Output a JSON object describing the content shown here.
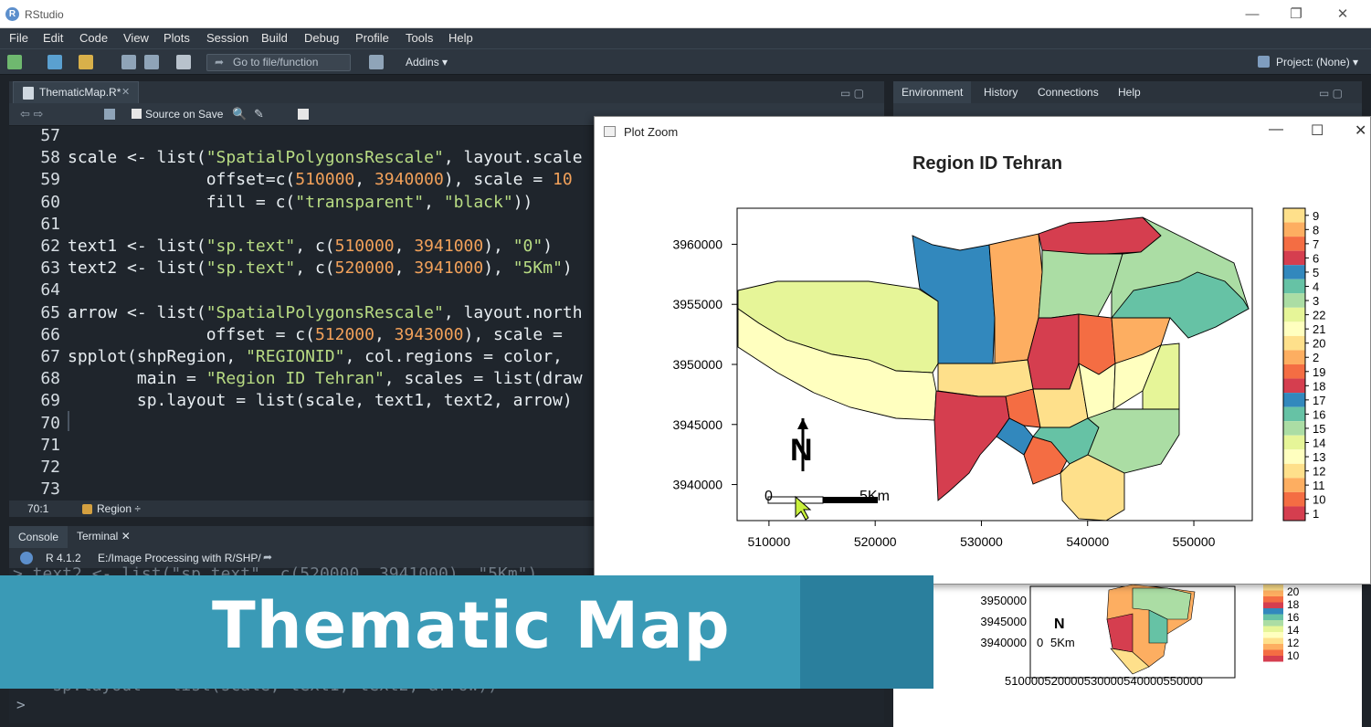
{
  "window": {
    "title": "RStudio"
  },
  "menu": [
    "File",
    "Edit",
    "Code",
    "View",
    "Plots",
    "Session",
    "Build",
    "Debug",
    "Profile",
    "Tools",
    "Help"
  ],
  "toolbar": {
    "goto_placeholder": "Go to file/function",
    "addins": "Addins",
    "project": "Project: (None)"
  },
  "editor": {
    "tab_label": "ThematicMap.R*",
    "source_on_save": "Source on Save",
    "lines": [
      {
        "no": "57",
        "segments": []
      },
      {
        "no": "58",
        "segments": [
          {
            "t": "scale <- list(",
            "c": ""
          },
          {
            "t": "\"SpatialPolygonsRescale\"",
            "c": "str"
          },
          {
            "t": ", layout.scale",
            "c": ""
          }
        ]
      },
      {
        "no": "59",
        "segments": [
          {
            "t": "              offset=c(",
            "c": ""
          },
          {
            "t": "510000",
            "c": "num"
          },
          {
            "t": ", ",
            "c": ""
          },
          {
            "t": "3940000",
            "c": "num"
          },
          {
            "t": "), scale = ",
            "c": ""
          },
          {
            "t": "10",
            "c": "num"
          }
        ]
      },
      {
        "no": "60",
        "segments": [
          {
            "t": "              fill = c(",
            "c": ""
          },
          {
            "t": "\"transparent\"",
            "c": "str"
          },
          {
            "t": ", ",
            "c": ""
          },
          {
            "t": "\"black\"",
            "c": "str"
          },
          {
            "t": "))",
            "c": ""
          }
        ]
      },
      {
        "no": "61",
        "segments": []
      },
      {
        "no": "62",
        "segments": [
          {
            "t": "text1 <- list(",
            "c": ""
          },
          {
            "t": "\"sp.text\"",
            "c": "str"
          },
          {
            "t": ", c(",
            "c": ""
          },
          {
            "t": "510000",
            "c": "num"
          },
          {
            "t": ", ",
            "c": ""
          },
          {
            "t": "3941000",
            "c": "num"
          },
          {
            "t": "), ",
            "c": ""
          },
          {
            "t": "\"0\"",
            "c": "str"
          },
          {
            "t": ")",
            "c": ""
          }
        ]
      },
      {
        "no": "63",
        "segments": [
          {
            "t": "text2 <- list(",
            "c": ""
          },
          {
            "t": "\"sp.text\"",
            "c": "str"
          },
          {
            "t": ", c(",
            "c": ""
          },
          {
            "t": "520000",
            "c": "num"
          },
          {
            "t": ", ",
            "c": ""
          },
          {
            "t": "3941000",
            "c": "num"
          },
          {
            "t": "), ",
            "c": ""
          },
          {
            "t": "\"5Km\"",
            "c": "str"
          },
          {
            "t": ")",
            "c": ""
          }
        ]
      },
      {
        "no": "64",
        "segments": []
      },
      {
        "no": "65",
        "segments": [
          {
            "t": "arrow <- list(",
            "c": ""
          },
          {
            "t": "\"SpatialPolygonsRescale\"",
            "c": "str"
          },
          {
            "t": ", layout.north",
            "c": ""
          }
        ]
      },
      {
        "no": "66",
        "segments": [
          {
            "t": "              offset = c(",
            "c": ""
          },
          {
            "t": "512000",
            "c": "num"
          },
          {
            "t": ", ",
            "c": ""
          },
          {
            "t": "3943000",
            "c": "num"
          },
          {
            "t": "), scale = ",
            "c": ""
          }
        ]
      },
      {
        "no": "67",
        "segments": [
          {
            "t": "spplot(shpRegion, ",
            "c": ""
          },
          {
            "t": "\"REGIONID\"",
            "c": "str"
          },
          {
            "t": ", col.regions = color,",
            "c": ""
          }
        ]
      },
      {
        "no": "68",
        "segments": [
          {
            "t": "       main = ",
            "c": ""
          },
          {
            "t": "\"Region ID Tehran\"",
            "c": "str"
          },
          {
            "t": ", scales = list(draw",
            "c": ""
          }
        ]
      },
      {
        "no": "69",
        "segments": [
          {
            "t": "       sp.layout = list(scale, text1, text2, arrow)",
            "c": ""
          }
        ]
      },
      {
        "no": "70",
        "segments": []
      },
      {
        "no": "71",
        "segments": []
      },
      {
        "no": "72",
        "segments": []
      },
      {
        "no": "73",
        "segments": []
      }
    ],
    "status_position": "70:1",
    "status_scope": "Region ÷"
  },
  "console": {
    "tabs": [
      "Console",
      "Terminal"
    ],
    "r_version": "R 4.1.2",
    "path": "E:/Image Processing with R/SHP/",
    "ghost_top": "> text2 <- list(\"sp.text\", c(520000, 3941000), \"5Km\")",
    "ghost_bottom": "    sp.layout = list(scale, text1, text2, arrow))",
    "prompt": ">"
  },
  "env": {
    "tabs": [
      "Environment",
      "History",
      "Connections",
      "Help"
    ]
  },
  "zoom_window": {
    "title": "Plot Zoom"
  },
  "chart_data": {
    "type": "heatmap",
    "title": "Region ID Tehran",
    "x_ticks": [
      "510000",
      "520000",
      "530000",
      "540000",
      "550000"
    ],
    "y_ticks": [
      "3960000",
      "3955000",
      "3950000",
      "3945000",
      "3940000"
    ],
    "xlim": [
      507000,
      555500
    ],
    "ylim": [
      3937000,
      3963000
    ],
    "legend_placement": "right",
    "legend": [
      {
        "label": "9",
        "color": "#fee08b"
      },
      {
        "label": "8",
        "color": "#fdae61"
      },
      {
        "label": "7",
        "color": "#f46d43"
      },
      {
        "label": "6",
        "color": "#d53e4f"
      },
      {
        "label": "5",
        "color": "#3288bd"
      },
      {
        "label": "4",
        "color": "#66c2a5"
      },
      {
        "label": "3",
        "color": "#abdda4"
      },
      {
        "label": "22",
        "color": "#e6f598"
      },
      {
        "label": "21",
        "color": "#ffffbf"
      },
      {
        "label": "20",
        "color": "#fee08b"
      },
      {
        "label": "2",
        "color": "#fdae61"
      },
      {
        "label": "19",
        "color": "#f46d43"
      },
      {
        "label": "18",
        "color": "#d53e4f"
      },
      {
        "label": "17",
        "color": "#3288bd"
      },
      {
        "label": "16",
        "color": "#66c2a5"
      },
      {
        "label": "15",
        "color": "#abdda4"
      },
      {
        "label": "14",
        "color": "#e6f598"
      },
      {
        "label": "13",
        "color": "#ffffbf"
      },
      {
        "label": "12",
        "color": "#fee08b"
      },
      {
        "label": "11",
        "color": "#fdae61"
      },
      {
        "label": "10",
        "color": "#f46d43"
      },
      {
        "label": "1",
        "color": "#d53e4f"
      }
    ],
    "annotations": {
      "north_label": "N",
      "scale_start": "0",
      "scale_end": "5Km"
    }
  },
  "mini_plot": {
    "y_ticks": [
      "3950000",
      "3945000",
      "3940000"
    ],
    "x_ticks": "510000520000530000540000550000",
    "legend": [
      "20",
      "18",
      "16",
      "14",
      "12",
      "10"
    ],
    "north_label": "N",
    "scale_start": "0",
    "scale_end": "5Km"
  },
  "banner": {
    "text": "Thematic Map",
    "color_main": "#3a9ab6",
    "color_accent": "#2a7f9d"
  }
}
